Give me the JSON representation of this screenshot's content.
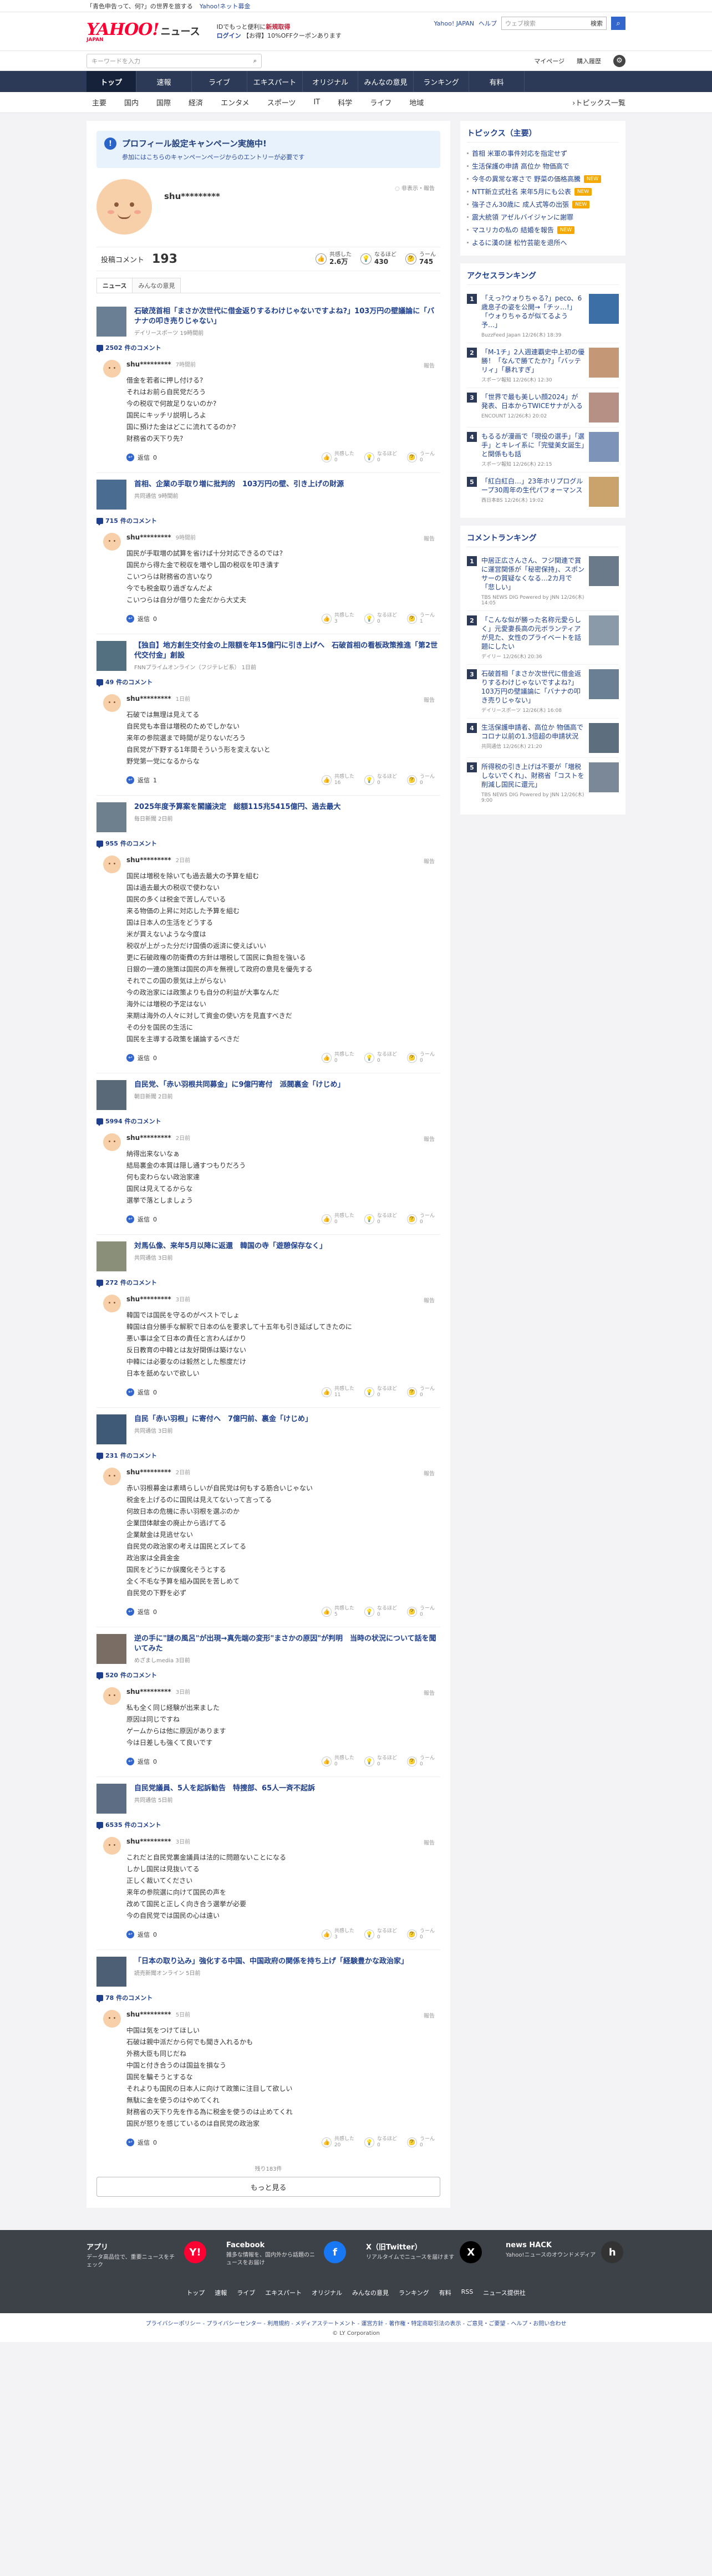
{
  "topstrip": {
    "promo": "「青色申告って、何?」の世界を旅する",
    "link": "Yahoo!ネット募金"
  },
  "header": {
    "logo_main": "YAHOO!",
    "logo_sub": "JAPAN",
    "logo_news": "ニュース",
    "promo_line1": "IDでもっと便利に",
    "promo_line1_em": "新規取得",
    "promo_line2_link": "ログイン",
    "promo_line2": "【お得】10%OFFクーポンあります",
    "link_top": "Yahoo! JAPAN",
    "link_help": "ヘルプ",
    "search_placeholder": "ウェブ検索",
    "search_label": "検索"
  },
  "subbar": {
    "search_placeholder": "キーワードを入力",
    "mypage": "マイページ",
    "settings": "購入履歴"
  },
  "mainnav": [
    "トップ",
    "速報",
    "ライブ",
    "エキスパート",
    "オリジナル",
    "みんなの意見",
    "ランキング",
    "有料"
  ],
  "catnav": {
    "items": [
      "主要",
      "国内",
      "国際",
      "経済",
      "エンタメ",
      "スポーツ",
      "IT",
      "科学",
      "ライフ",
      "地域"
    ],
    "more": "トピックス一覧"
  },
  "notice": {
    "title": "プロフィール設定キャンペーン実施中!",
    "sub": "参加にはこちらのキャンペーンページからのエントリーが必要です"
  },
  "profile": {
    "name": "shu*********",
    "note": "非表示・報告",
    "comments_label": "投稿コメント",
    "comments_count": "193",
    "reacts": [
      {
        "label": "共感した",
        "value": "2.6万",
        "icon": "👍"
      },
      {
        "label": "なるほど",
        "value": "430",
        "icon": "💡"
      },
      {
        "label": "うーん",
        "value": "745",
        "icon": "🤔"
      }
    ]
  },
  "tabs": [
    "ニュース",
    "みんなの意見"
  ],
  "labels": {
    "report": "報告",
    "reply": "返信",
    "agree": "共感した",
    "hmm": "なるほど",
    "meh": "うーん",
    "comments_suffix": "件のコメント"
  },
  "entries": [
    {
      "title": "石破茂首相「まさか次世代に借金返りするわけじゃないですよね?」103万円の壁議論に「バナナの叩き売りじゃない」",
      "source": "デイリースポーツ 19時間前",
      "thumb": "#6a7f93",
      "count": "2502",
      "user": "shu*********",
      "time": "7時間前",
      "text": "借金を若者に押し付ける?\nそれはお前ら自民党だろう\n今の税収で何故足りないのか?\n国民にキッチリ説明しろよ\n国に預けた金はどこに流れてるのか?\n財務省の天下り先?",
      "reply": "0",
      "r": [
        "0",
        "0",
        "0"
      ]
    },
    {
      "title": "首相、企業の手取り増に批判的　103万円の壁、引き上げの財源",
      "source": "共同通信 9時間前",
      "thumb": "#4a6c91",
      "count": "715",
      "user": "shu*********",
      "time": "9時間前",
      "text": "国民が手取増の試算を省けば十分対応できるのでは?\n国民から得た金で税収を増やし国の税収を叩き潰す\nこいつらは財務省の言いなり\n今でも税金取り過ぎなんだよ\nこいつらは自分が借りた金だから大丈夫",
      "reply": "0",
      "r": [
        "3",
        "0",
        "1"
      ]
    },
    {
      "title": "【独自】地方創生交付金の上限額を年15億円に引き上げへ　石破首相の看板政策推進「第2世代交付金」創設",
      "source": "FNNプライムオンライン（フジテレビ系） 1日前",
      "thumb": "#52707f",
      "count": "49",
      "user": "shu*********",
      "time": "1日前",
      "text": "石破では無理は見えてる\n自民党も本音は増税のためでしかない\n来年の参院選まで時間が足りないだろう\n自民党が下野する1年間そういう形を変えないと\n野党第一党になるからな",
      "reply": "1",
      "r": [
        "16",
        "0",
        "0"
      ]
    },
    {
      "title": "2025年度予算案を閣議決定　総額115兆5415億円、過去最大",
      "source": "毎日新聞 2日前",
      "thumb": "#6e7f8e",
      "count": "955",
      "user": "shu*********",
      "time": "2日前",
      "text": "国民は増税を除いても過去最大の予算を組む\n国は過去最大の税収で使わない\n国民の多くは税金で苦しんでいる\n来る物価の上昇に対応した予算を組む\n国は日本人の生活をどうする\n米が買えないような今度は\n税収が上がった分だけ国債の返済に使えばいい\n更に石破政権の防衛費の方針は増税して国民に負担を強いる\n日銀の一連の施策は国民の声を無視して政府の意見を優先する\nそれでこの国の景気は上がらない\n今の政治家には政策よりも自分の利益が大事なんだ\n海外には増税の予定はない\n来期は海外の人々に対して資金の使い方を見直すべきだ\nその分を国民の生活に\n国民を主導する政策を議論するべきだ",
      "reply": "0",
      "r": [
        "0",
        "0",
        "0"
      ]
    },
    {
      "title": "自民党、「赤い羽根共同募金」に9億円寄付　派閥裏金「けじめ」",
      "source": "朝日新聞 2日前",
      "thumb": "#5a6977",
      "count": "5994",
      "user": "shu*********",
      "time": "2日前",
      "text": "納得出来ないなぁ\n結局裏金の本質は隠し通すつもりだろう\n何も変わらない政治家達\n国民は見えてるからな\n選挙で落としましょう",
      "reply": "0",
      "r": [
        "0",
        "0",
        "0"
      ]
    },
    {
      "title": "対馬仏像、来年5月以降に返還　韓国の寺「遊憩保存なく」",
      "source": "共同通信 3日前",
      "thumb": "#8a8f7a",
      "count": "272",
      "user": "shu*********",
      "time": "3日前",
      "text": "韓国では国民を守るのがベストでしょ\n韓国は自分勝手な解釈で日本の仏を要求して十五年も引き延ばしてきたのに\n悪い事は全て日本の責任と言わんばかり\n反日教育の中韓とは友好関係は築けない\n中韓には必要なのは毅然とした態度だけ\n日本を舐めないで欲しい",
      "reply": "0",
      "r": [
        "11",
        "0",
        "0"
      ]
    },
    {
      "title": "自民「赤い羽根」に寄付へ　7億円前、裏金「けじめ」",
      "source": "共同通信 3日前",
      "thumb": "#3f5a76",
      "count": "231",
      "user": "shu*********",
      "time": "2日前",
      "text": "赤い羽根募金は素晴らしいが自民党は何もする筋合いじゃない\n税金を上げるのに国民は見えてないって言ってる\n何故日本の危機に赤い羽根を選ぶのか\n企業団体献金の廃止から逃げてる\n企業献金は見逃せない\n自民党の政治家の考えは国民とズレてる\n政治家は全員金金\n国民をどうにか誤魔化そうとする\n全く不毛な予算を組み国民を苦しめて\n自民党の下野を必ず",
      "reply": "0",
      "r": [
        "5",
        "0",
        "0"
      ]
    },
    {
      "title": "逆の手に\"謎の風呂\"が出現→真先端の変形\"まさかの原因\"が判明　当時の状況について話を聞いてみた",
      "source": "めざましmedia 3日前",
      "thumb": "#7a6e64",
      "count": "520",
      "user": "shu*********",
      "time": "3日前",
      "text": "私も全く同じ経験が出来ました\n原因は同じですね\nゲームからは他に原因があります\n今は日差しも強くて良いです",
      "reply": "0",
      "r": [
        "0",
        "0",
        "0"
      ]
    },
    {
      "title": "自民党議員、5人を起訴勧告　特捜部、65人一斉不起訴",
      "source": "共同通信 5日前",
      "thumb": "#5c6d84",
      "count": "6535",
      "user": "shu*********",
      "time": "3日前",
      "text": "これだと自民党裏金議員は法的に問題ないことになる\nしかし国民は見抜いてる\n正しく裁いてください\n来年の参院選に向けて国民の声を\n改めて国民と正しく向き合う選挙が必要\n今の自民党では国民の心は遠い",
      "reply": "0",
      "r": [
        "3",
        "0",
        "0"
      ]
    },
    {
      "title": "「日本の取り込み」強化する中国、中国政府の関係を持ち上げ「経験豊かな政治家」",
      "source": "読売新聞オンライン 5日前",
      "thumb": "#4d5f74",
      "count": "78",
      "user": "shu*********",
      "time": "5日前",
      "text": "中国は気をつけてほしい\n石破は親中派だから何でも聞き入れるかも\n外務大臣も同じだね\n中国と付き合うのは国益を損なう\n国民を騙そうとするな\nそれよりも国民の日本人に向けて政策に注目して欲しい\n無駄に金を使うのはやめてくれ\n財務省の天下り先を作る為に税金を使うのは止めてくれ\n国民が怒りを感じているのは自民党の政治家",
      "reply": "0",
      "r": [
        "20",
        "0",
        "0"
      ]
    }
  ],
  "more": {
    "count": "残り183件",
    "label": "もっと見る"
  },
  "side_topics": {
    "title": "トピックス（主要）",
    "items": [
      {
        "text": "首相 米軍の事件対応を指定せず",
        "badge": ""
      },
      {
        "text": "生活保護の申請 高位か 物価高で",
        "badge": ""
      },
      {
        "text": "今冬の異常な寒さで 野菜の価格高騰",
        "badge": "NEW"
      },
      {
        "text": "NTT新立式社名 来年5月にも公表",
        "badge": "NEW"
      },
      {
        "text": "強子さん30歳に 成人式等の出張",
        "badge": "NEW"
      },
      {
        "text": "震大統領 アゼルバイジャンに謝罪",
        "badge": ""
      },
      {
        "text": "マユリカの私の 結婚を報告",
        "badge": "NEW"
      },
      {
        "text": "よるに漢の謎 松竹芸能を退所へ",
        "badge": ""
      }
    ]
  },
  "side_access": {
    "title": "アクセスランキング",
    "items": [
      {
        "text": "「えっ?ウォりちゃる?」peco、6歳息子の姿を公開→「チッ…!」「ウォりちゃるが似てるよう予…」",
        "src": "BuzzFeed Japan 12/26(木) 18:39",
        "img": "#3b6fa5"
      },
      {
        "text": "「M-1チ」2人週連覇史中上初の優勝！「なんで勝てたか?」「バッテリィ」「暴れすぎ」",
        "src": "スポーツ報知 12/26(木) 12:30",
        "img": "#c49776"
      },
      {
        "text": "「世界で最も美しい顔2024」が発表、日本からTWICEサナが入る",
        "src": "ENCOUNT 12/26(木) 20:02",
        "img": "#b69084"
      },
      {
        "text": "もるるが漫画で「現役の選手」「選手」とキレイ系に「完璧美女誕生」と関係もも話",
        "src": "スポーツ報知 12/26(木) 22:15",
        "img": "#7d93b7"
      },
      {
        "text": "「紅白紅白…」23年ホリプログループ30周年の生代パフォーマンス",
        "src": "西日本BS 12/26(木) 19:02",
        "img": "#c9a36b"
      }
    ]
  },
  "side_comment": {
    "title": "コメントランキング",
    "items": [
      {
        "text": "中居正広さんさん、フジ関連で賞に運営関係が「秘密保持」、スポンサーの質疑なくなる…2カ月で「悲しい」",
        "src": "TBS NEWS DIG Powered by JNN 12/26(木) 14:05",
        "img": "#6b7a8a"
      },
      {
        "text": "「こんな似が勝った名称元愛らしく」元愛妻長高の元ボランティアが見た、女性のプライベートを話題にしたい",
        "src": "デイリー 12/26(木) 20:36",
        "img": "#8b9aa8"
      },
      {
        "text": "石破首相「まさか次世代に借金返りするわけじゃないですよね?」103万円の壁議論に「バナナの叩き売りじゃない」",
        "src": "デイリースポーツ 12/26(木) 16:08",
        "img": "#6a7f93"
      },
      {
        "text": "生活保護申請者、高位か 物価高でコロナ以前の1.3倍超の申請状況",
        "src": "共同通信 12/26(木) 21:20",
        "img": "#5d6e7e"
      },
      {
        "text": "所得税の引き上げは不要が「増税しないでくれ」、財務省「コストを削減し国民に還元」",
        "src": "TBS NEWS DIG Powered by JNN 12/26(木) 9:00",
        "img": "#7a8898"
      }
    ]
  },
  "footer": {
    "apps": [
      {
        "title": "アプリ",
        "desc": "データ高品位で、重要ニュースをチェック",
        "icon": "Y!",
        "color": "#ff0033"
      },
      {
        "title": "Facebook",
        "desc": "雑多な情報を、国内外から話題のニュースをお届け",
        "icon": "f",
        "color": "#1877f2"
      },
      {
        "title": "X（旧Twitter）",
        "desc": "リアルタイムでニュースを届けます",
        "icon": "X",
        "color": "#000000"
      },
      {
        "title": "news HACK",
        "desc": "Yahoo!ニュースのオウンドメディア",
        "icon": "h",
        "color": "#333333"
      }
    ],
    "nav": [
      "トップ",
      "速報",
      "ライブ",
      "エキスパート",
      "オリジナル",
      "みんなの意見",
      "ランキング",
      "有料",
      "RSS",
      "ニュース提供社"
    ],
    "legal": "プライバシーポリシー - プライバシーセンター - 利用規約 - メディアステートメント - 運営方針 - 著作権・特定商取引法の表示 - ご意見・ご要望 - ヘルプ・お問い合わせ",
    "copy": "© LY Corporation"
  }
}
